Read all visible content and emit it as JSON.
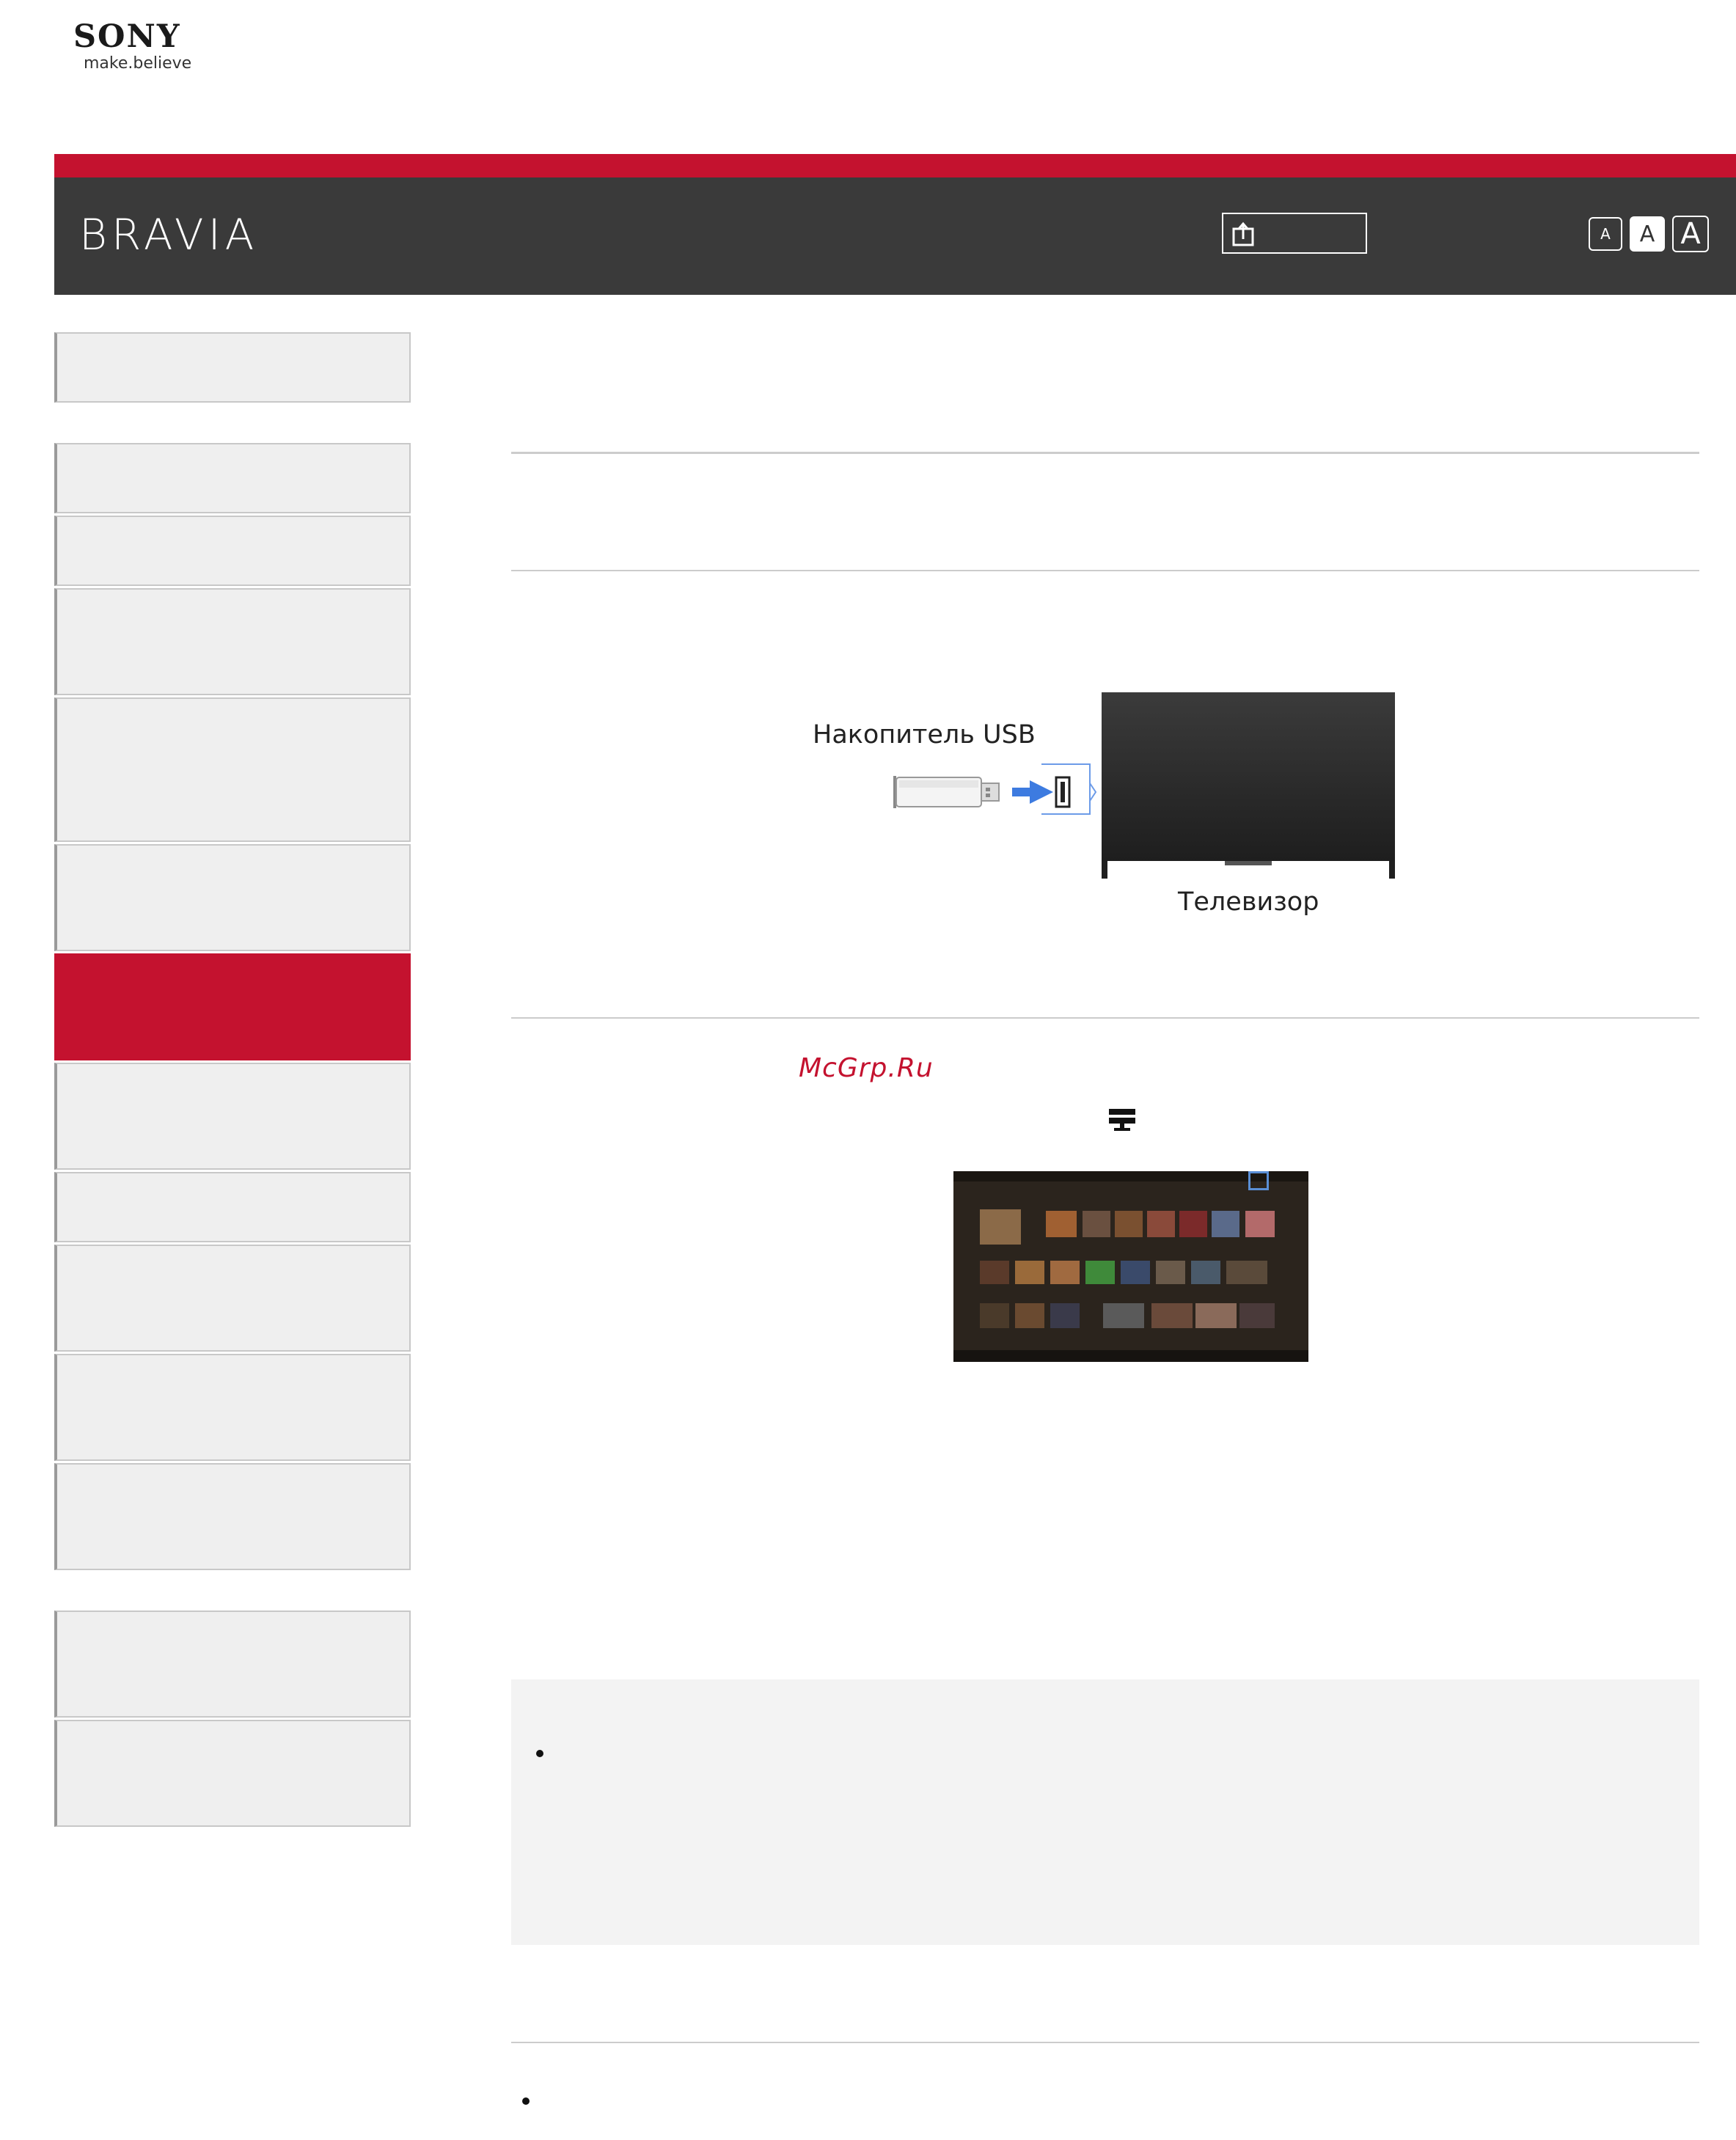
{
  "logo": {
    "brand": "SONY",
    "tagline": "make.believe"
  },
  "header": {
    "title": "BRAVIA",
    "share_icon": "share-icon",
    "font_size_options": [
      "A",
      "A",
      "A"
    ]
  },
  "diagram": {
    "usb_label": "Накопитель USB",
    "tv_label": "Телевизор"
  },
  "watermark": "McGrp.Ru",
  "icons": {
    "network": "network-icon"
  },
  "colors": {
    "accent": "#c4122f",
    "header_bg": "#3a3a3a",
    "nav_bg": "#efefef",
    "highlight": "#5a8fd6"
  }
}
